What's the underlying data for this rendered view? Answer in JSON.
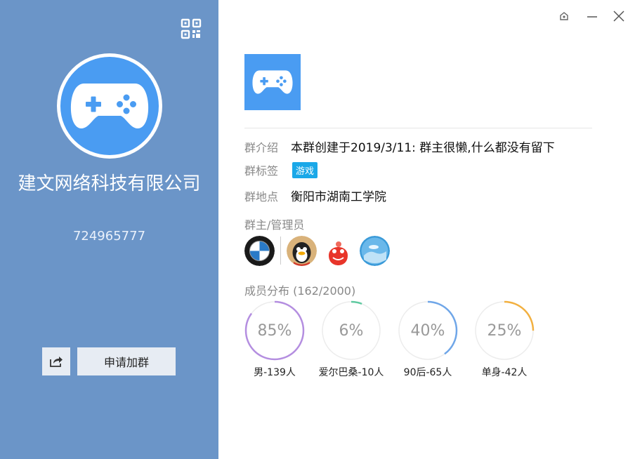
{
  "group": {
    "name": "建文网络科技有限公司",
    "id": "724965777"
  },
  "actions": {
    "join_label": "申请加群"
  },
  "info": {
    "intro_label": "群介绍",
    "intro_value": "本群创建于2019/3/11: 群主很懒,什么都没有留下",
    "tag_label": "群标签",
    "tag_value": "游戏",
    "location_label": "群地点",
    "location_value": "衡阳市湖南工学院"
  },
  "admins": {
    "title": "群主/管理员"
  },
  "members": {
    "title": "成员分布 (162/2000)",
    "stats": [
      {
        "percent": 85,
        "percent_text": "85%",
        "label": "男-139人",
        "color": "#b48ee0"
      },
      {
        "percent": 6,
        "percent_text": "6%",
        "label": "爱尔巴桑-10人",
        "color": "#5fc9a0"
      },
      {
        "percent": 40,
        "percent_text": "40%",
        "label": "90后-65人",
        "color": "#6fa6e8"
      },
      {
        "percent": 25,
        "percent_text": "25%",
        "label": "单身-42人",
        "color": "#f2b040"
      }
    ]
  },
  "colors": {
    "left_panel": "#6b95c8",
    "avatar_blue": "#4a9cf2",
    "tag_blue": "#1aa8e8"
  }
}
